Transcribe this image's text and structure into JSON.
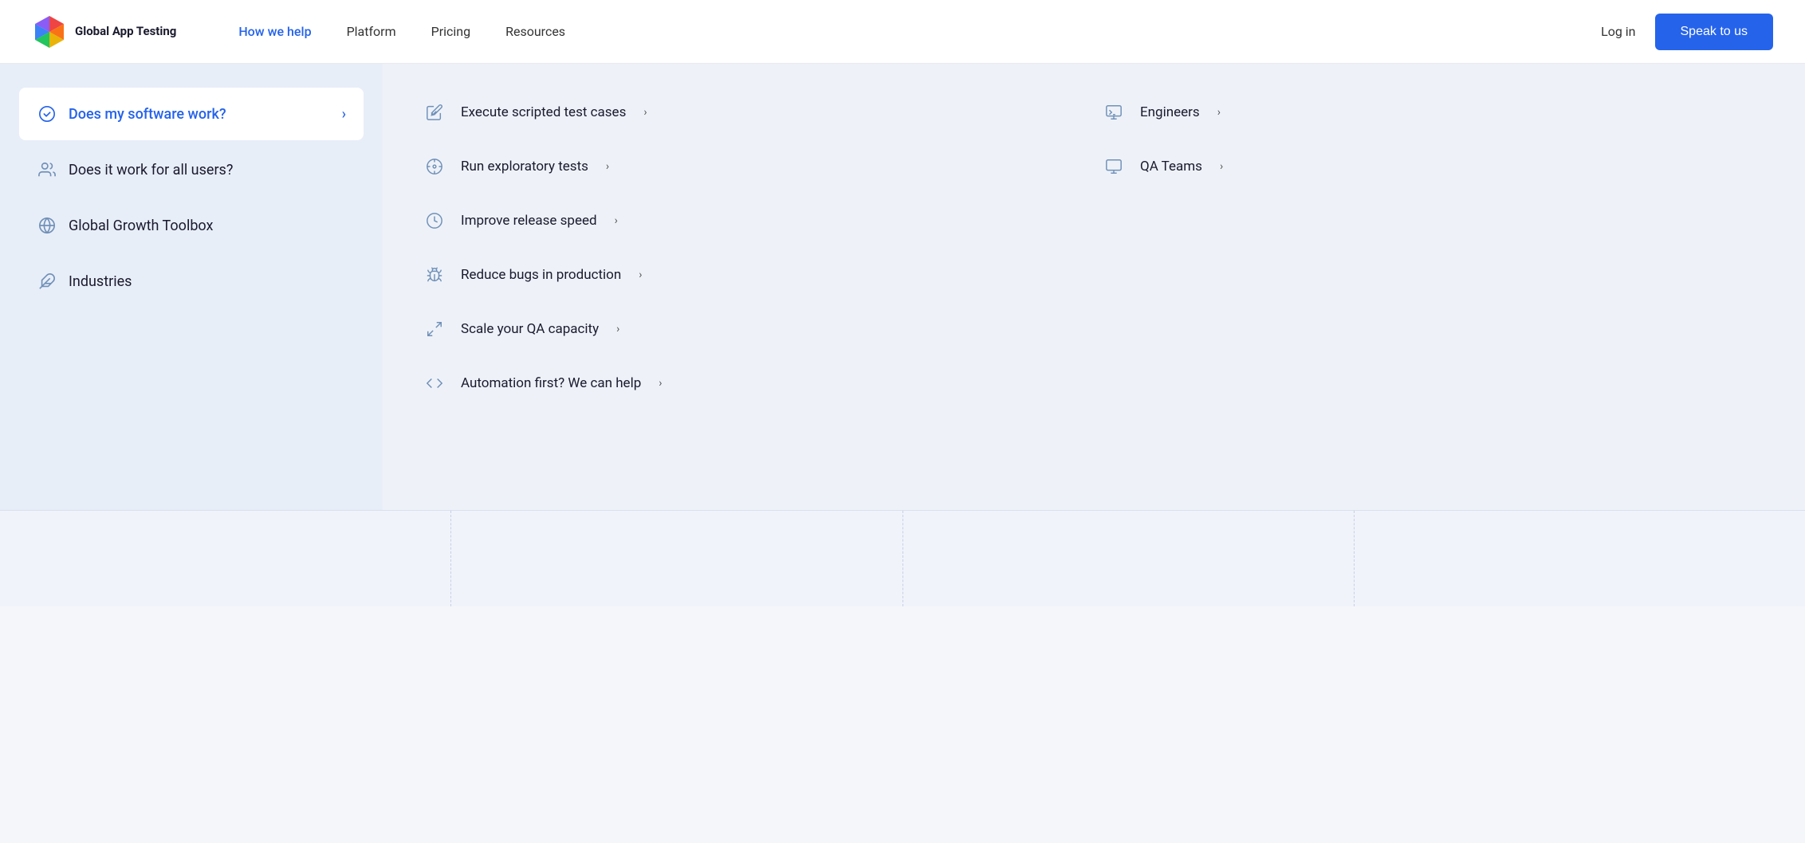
{
  "navbar": {
    "logo_name": "Global\nApp Testing",
    "links": [
      {
        "label": "How we help",
        "active": true
      },
      {
        "label": "Platform",
        "active": false
      },
      {
        "label": "Pricing",
        "active": false
      },
      {
        "label": "Resources",
        "active": false
      }
    ],
    "login_label": "Log in",
    "speak_label": "Speak to us"
  },
  "dropdown": {
    "left_items": [
      {
        "label": "Does my software work?",
        "active": true,
        "icon": "check-circle"
      },
      {
        "label": "Does it work for all users?",
        "active": false,
        "icon": "users"
      },
      {
        "label": "Global Growth Toolbox",
        "active": false,
        "icon": "globe"
      },
      {
        "label": "Industries",
        "active": false,
        "icon": "feather"
      }
    ],
    "right_col1": [
      {
        "label": "Execute scripted test cases",
        "icon": "edit-check"
      },
      {
        "label": "Run exploratory tests",
        "icon": "compass"
      },
      {
        "label": "Improve release speed",
        "icon": "clock"
      },
      {
        "label": "Reduce bugs in production",
        "icon": "bug"
      },
      {
        "label": "Scale your QA capacity",
        "icon": "expand"
      },
      {
        "label": "Automation first? We can help",
        "icon": "code"
      }
    ],
    "right_col2": [
      {
        "label": "Engineers",
        "icon": "terminal"
      },
      {
        "label": "QA Teams",
        "icon": "monitor"
      }
    ]
  }
}
